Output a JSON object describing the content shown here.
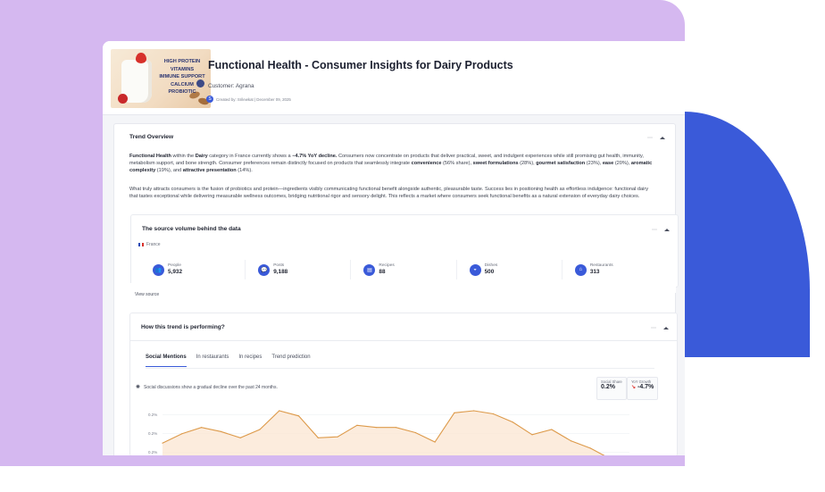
{
  "header": {
    "thumbnail_lines": [
      "HIGH PROTEIN",
      "VITAMINS",
      "IMMUNE SUPPORT",
      "CALCIUM",
      "PROBIOTIC"
    ],
    "title": "Functional Health - Consumer Insights for Dairy Products",
    "customer": "Customer: Agrana",
    "avatar_initial": "S",
    "created_by": "Created by: Srilewkat | December 09, 2025"
  },
  "overview": {
    "title": "Trend Overview",
    "para1_segments": [
      {
        "t": "Functional Health",
        "b": true
      },
      {
        "t": " within the ",
        "b": false
      },
      {
        "t": "Dairy",
        "b": true
      },
      {
        "t": " category in France currently shows a ",
        "b": false
      },
      {
        "t": "−4.7% YoY decline.",
        "b": true
      },
      {
        "t": " Consumers now concentrate on products that deliver practical, sweet, and indulgent experiences while still promising gut health, immunity, metabolism support, and bone strength. Consumer preferences remain distinctly focused on products that seamlessly integrate ",
        "b": false
      },
      {
        "t": "convenience",
        "b": true
      },
      {
        "t": " (56% share), ",
        "b": false
      },
      {
        "t": "sweet formulations",
        "b": true
      },
      {
        "t": " (28%), ",
        "b": false
      },
      {
        "t": "gourmet satisfaction",
        "b": true
      },
      {
        "t": " (23%), ",
        "b": false
      },
      {
        "t": "ease",
        "b": true
      },
      {
        "t": " (20%), ",
        "b": false
      },
      {
        "t": "aromatic complexity",
        "b": true
      },
      {
        "t": " (19%), and ",
        "b": false
      },
      {
        "t": "attractive presentation",
        "b": true
      },
      {
        "t": " (14%).",
        "b": false
      }
    ],
    "para2": "What truly attracts consumers is the fusion of probiotics and protein—ingredients visibly communicating functional benefit alongside authentic, pleasurable taste. Success lies in positioning health as effortless indulgence: functional dairy that tastes exceptional while delivering measurable wellness outcomes, bridging nutritional rigor and sensory delight. This reflects a market where consumers seek functional benefits as a natural extension of everyday dairy choices."
  },
  "source": {
    "title": "The source volume behind the data",
    "country": "France",
    "stats": [
      {
        "label": "People",
        "value": "5,932",
        "icon": "people-icon",
        "glyph": "👥"
      },
      {
        "label": "Posts",
        "value": "9,188",
        "icon": "chat-icon",
        "glyph": "💬"
      },
      {
        "label": "Recipes",
        "value": "88",
        "icon": "book-icon",
        "glyph": "▤"
      },
      {
        "label": "Dishes",
        "value": "500",
        "icon": "dish-icon",
        "glyph": "◒"
      },
      {
        "label": "Restaurants",
        "value": "313",
        "icon": "restaurant-icon",
        "glyph": "⌂"
      }
    ],
    "view_source": "View source"
  },
  "performance": {
    "title": "How this trend is performing?",
    "tabs": [
      "Social Mentions",
      "In restaurants",
      "In recipes",
      "Trend prediction"
    ],
    "insight": "Social discussions show a gradual decline over the past 24 months.",
    "kpi_share_label": "Social Share",
    "kpi_share_value": "0.2%",
    "kpi_growth_label": "YoY Growth",
    "kpi_growth_value": "-4.7%",
    "kpi_growth_arrow": "↘"
  },
  "colors": {
    "accent": "#3a5ad9",
    "line": "#dd9a4a",
    "fill": "#fbe6d2"
  },
  "chart_data": {
    "type": "area",
    "ytick_labels": [
      "0.2%",
      "0.2%",
      "0.2%"
    ],
    "values": [
      0.202,
      0.211,
      0.217,
      0.213,
      0.207,
      0.215,
      0.233,
      0.228,
      0.207,
      0.208,
      0.219,
      0.217,
      0.217,
      0.212,
      0.203,
      0.231,
      0.233,
      0.23,
      0.222,
      0.21,
      0.215,
      0.204,
      0.197,
      0.187,
      0.185
    ]
  }
}
